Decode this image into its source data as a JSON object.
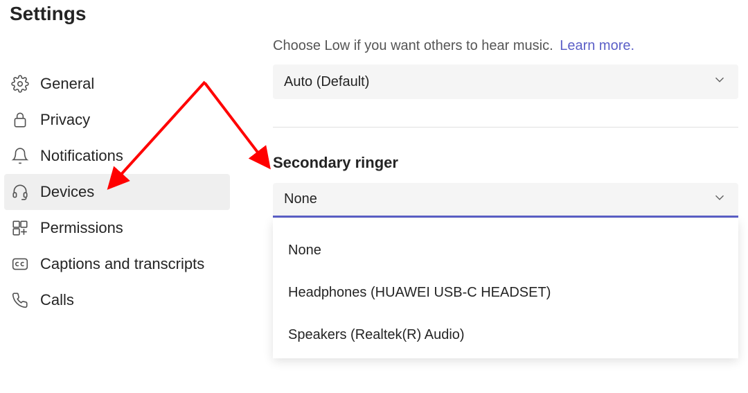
{
  "title": "Settings",
  "sidebar": {
    "items": [
      {
        "label": "General"
      },
      {
        "label": "Privacy"
      },
      {
        "label": "Notifications"
      },
      {
        "label": "Devices"
      },
      {
        "label": "Permissions"
      },
      {
        "label": "Captions and transcripts"
      },
      {
        "label": "Calls"
      }
    ],
    "selected_index": 3
  },
  "noise_suppression": {
    "hint": "Choose Low if you want others to hear music.",
    "learn_more": "Learn more.",
    "selected": "Auto (Default)"
  },
  "secondary_ringer": {
    "title": "Secondary ringer",
    "selected": "None",
    "options": [
      "None",
      "Headphones (HUAWEI USB-C HEADSET)",
      "Speakers (Realtek(R) Audio)"
    ]
  },
  "annotation": {
    "color": "#ff0000"
  }
}
